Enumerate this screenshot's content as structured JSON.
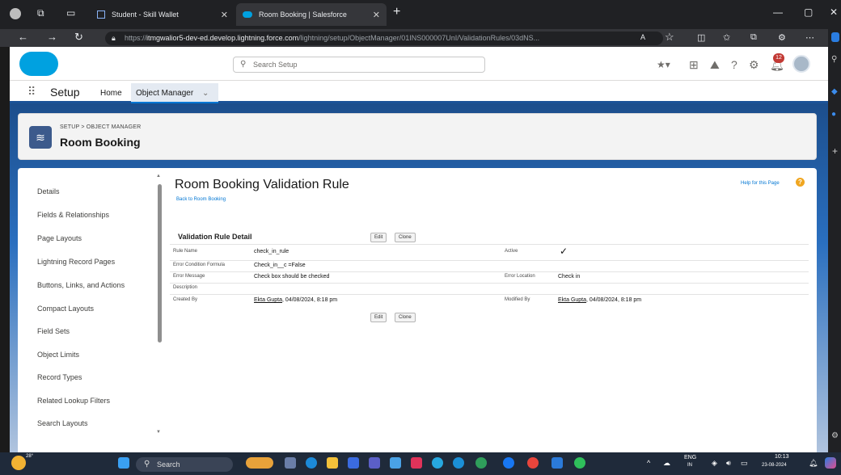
{
  "browser": {
    "tabs": [
      {
        "label": "Student - Skill Wallet"
      },
      {
        "label": "Room Booking | Salesforce"
      }
    ],
    "new_tab": "+",
    "url_prefix": "https://",
    "url_host": "itmgwalior5-dev-ed.develop.lightning.force.com",
    "url_path": "/lightning/setup/ObjectManager/01INS000007UnI/ValidationRules/03dNS...",
    "window_controls": {
      "minimize": "—",
      "restore": "▢",
      "close": "✕"
    }
  },
  "sf_header": {
    "search_placeholder": "Search Setup",
    "notification_count": "12"
  },
  "nav": {
    "app_name": "Setup",
    "home": "Home",
    "object_manager": "Object Manager"
  },
  "object_header": {
    "breadcrumb": "SETUP > OBJECT MANAGER",
    "title": "Room Booking"
  },
  "left_nav": {
    "items": [
      "Details",
      "Fields & Relationships",
      "Page Layouts",
      "Lightning Record Pages",
      "Buttons, Links, and Actions",
      "Compact Layouts",
      "Field Sets",
      "Object Limits",
      "Record Types",
      "Related Lookup Filters",
      "Search Layouts"
    ]
  },
  "main": {
    "title": "Room Booking Validation Rule",
    "back_link": "Back to Room Booking",
    "help_link": "Help for this Page",
    "section_title": "Validation Rule Detail",
    "edit_label": "Edit",
    "clone_label": "Clone",
    "fields": {
      "rule_name_label": "Rule Name",
      "rule_name_value": "check_in_rule",
      "active_label": "Active",
      "active_value": "✓",
      "formula_label": "Error Condition Formula",
      "formula_value": "Check_in__c =False",
      "message_label": "Error Message",
      "message_value": "Check box should be checked",
      "location_label": "Error Location",
      "location_value": "Check in",
      "description_label": "Description",
      "created_label": "Created By",
      "created_user": "Ekta Gupta",
      "created_date": ", 04/08/2024, 8:18 pm",
      "modified_label": "Modified By",
      "modified_user": "Ekta Gupta",
      "modified_date": ", 04/08/2024, 8:18 pm"
    }
  },
  "taskbar": {
    "search": "Search",
    "weather": "28°",
    "lang": "ENG",
    "region": "IN",
    "time": "10:13",
    "date": "23-08-2024"
  }
}
